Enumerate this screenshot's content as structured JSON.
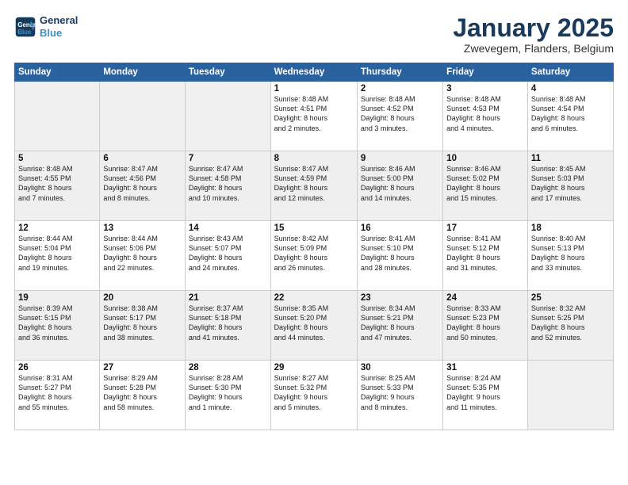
{
  "header": {
    "logo_line1": "General",
    "logo_line2": "Blue",
    "month": "January 2025",
    "location": "Zwevegem, Flanders, Belgium"
  },
  "weekdays": [
    "Sunday",
    "Monday",
    "Tuesday",
    "Wednesday",
    "Thursday",
    "Friday",
    "Saturday"
  ],
  "weeks": [
    [
      {
        "day": "",
        "info": ""
      },
      {
        "day": "",
        "info": ""
      },
      {
        "day": "",
        "info": ""
      },
      {
        "day": "1",
        "info": "Sunrise: 8:48 AM\nSunset: 4:51 PM\nDaylight: 8 hours\nand 2 minutes."
      },
      {
        "day": "2",
        "info": "Sunrise: 8:48 AM\nSunset: 4:52 PM\nDaylight: 8 hours\nand 3 minutes."
      },
      {
        "day": "3",
        "info": "Sunrise: 8:48 AM\nSunset: 4:53 PM\nDaylight: 8 hours\nand 4 minutes."
      },
      {
        "day": "4",
        "info": "Sunrise: 8:48 AM\nSunset: 4:54 PM\nDaylight: 8 hours\nand 6 minutes."
      }
    ],
    [
      {
        "day": "5",
        "info": "Sunrise: 8:48 AM\nSunset: 4:55 PM\nDaylight: 8 hours\nand 7 minutes."
      },
      {
        "day": "6",
        "info": "Sunrise: 8:47 AM\nSunset: 4:56 PM\nDaylight: 8 hours\nand 8 minutes."
      },
      {
        "day": "7",
        "info": "Sunrise: 8:47 AM\nSunset: 4:58 PM\nDaylight: 8 hours\nand 10 minutes."
      },
      {
        "day": "8",
        "info": "Sunrise: 8:47 AM\nSunset: 4:59 PM\nDaylight: 8 hours\nand 12 minutes."
      },
      {
        "day": "9",
        "info": "Sunrise: 8:46 AM\nSunset: 5:00 PM\nDaylight: 8 hours\nand 14 minutes."
      },
      {
        "day": "10",
        "info": "Sunrise: 8:46 AM\nSunset: 5:02 PM\nDaylight: 8 hours\nand 15 minutes."
      },
      {
        "day": "11",
        "info": "Sunrise: 8:45 AM\nSunset: 5:03 PM\nDaylight: 8 hours\nand 17 minutes."
      }
    ],
    [
      {
        "day": "12",
        "info": "Sunrise: 8:44 AM\nSunset: 5:04 PM\nDaylight: 8 hours\nand 19 minutes."
      },
      {
        "day": "13",
        "info": "Sunrise: 8:44 AM\nSunset: 5:06 PM\nDaylight: 8 hours\nand 22 minutes."
      },
      {
        "day": "14",
        "info": "Sunrise: 8:43 AM\nSunset: 5:07 PM\nDaylight: 8 hours\nand 24 minutes."
      },
      {
        "day": "15",
        "info": "Sunrise: 8:42 AM\nSunset: 5:09 PM\nDaylight: 8 hours\nand 26 minutes."
      },
      {
        "day": "16",
        "info": "Sunrise: 8:41 AM\nSunset: 5:10 PM\nDaylight: 8 hours\nand 28 minutes."
      },
      {
        "day": "17",
        "info": "Sunrise: 8:41 AM\nSunset: 5:12 PM\nDaylight: 8 hours\nand 31 minutes."
      },
      {
        "day": "18",
        "info": "Sunrise: 8:40 AM\nSunset: 5:13 PM\nDaylight: 8 hours\nand 33 minutes."
      }
    ],
    [
      {
        "day": "19",
        "info": "Sunrise: 8:39 AM\nSunset: 5:15 PM\nDaylight: 8 hours\nand 36 minutes."
      },
      {
        "day": "20",
        "info": "Sunrise: 8:38 AM\nSunset: 5:17 PM\nDaylight: 8 hours\nand 38 minutes."
      },
      {
        "day": "21",
        "info": "Sunrise: 8:37 AM\nSunset: 5:18 PM\nDaylight: 8 hours\nand 41 minutes."
      },
      {
        "day": "22",
        "info": "Sunrise: 8:35 AM\nSunset: 5:20 PM\nDaylight: 8 hours\nand 44 minutes."
      },
      {
        "day": "23",
        "info": "Sunrise: 8:34 AM\nSunset: 5:21 PM\nDaylight: 8 hours\nand 47 minutes."
      },
      {
        "day": "24",
        "info": "Sunrise: 8:33 AM\nSunset: 5:23 PM\nDaylight: 8 hours\nand 50 minutes."
      },
      {
        "day": "25",
        "info": "Sunrise: 8:32 AM\nSunset: 5:25 PM\nDaylight: 8 hours\nand 52 minutes."
      }
    ],
    [
      {
        "day": "26",
        "info": "Sunrise: 8:31 AM\nSunset: 5:27 PM\nDaylight: 8 hours\nand 55 minutes."
      },
      {
        "day": "27",
        "info": "Sunrise: 8:29 AM\nSunset: 5:28 PM\nDaylight: 8 hours\nand 58 minutes."
      },
      {
        "day": "28",
        "info": "Sunrise: 8:28 AM\nSunset: 5:30 PM\nDaylight: 9 hours\nand 1 minute."
      },
      {
        "day": "29",
        "info": "Sunrise: 8:27 AM\nSunset: 5:32 PM\nDaylight: 9 hours\nand 5 minutes."
      },
      {
        "day": "30",
        "info": "Sunrise: 8:25 AM\nSunset: 5:33 PM\nDaylight: 9 hours\nand 8 minutes."
      },
      {
        "day": "31",
        "info": "Sunrise: 8:24 AM\nSunset: 5:35 PM\nDaylight: 9 hours\nand 11 minutes."
      },
      {
        "day": "",
        "info": ""
      }
    ]
  ]
}
